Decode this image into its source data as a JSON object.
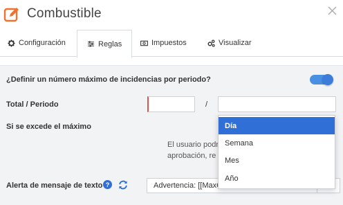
{
  "header": {
    "title": "Combustible",
    "brand_color": "#f0722f"
  },
  "tabs": [
    {
      "label": "Configuración",
      "icon": "gear-icon",
      "active": false
    },
    {
      "label": "Reglas",
      "icon": "sliders-icon",
      "active": true
    },
    {
      "label": "Impuestos",
      "icon": "money-icon",
      "active": false
    },
    {
      "label": "Visualizar",
      "icon": "gears-icon",
      "active": false
    }
  ],
  "form": {
    "max_question": "¿Definir un número máximo de incidencias por periodo?",
    "max_toggle_on": true,
    "total_label": "Total / Periodo",
    "total_value": "",
    "slash": "/",
    "period_value": "",
    "exceed_label": "Si se excede el máximo",
    "exceed_desc_line1": "El usuario podr",
    "exceed_desc_line2": "aprobación, re",
    "alert_label": "Alerta de mensaje de texto",
    "alert_value": "Advertencia: [[MaxC"
  },
  "dropdown": {
    "options": [
      "Día",
      "Semana",
      "Mes",
      "Año"
    ],
    "selected": "Día"
  },
  "colors": {
    "accent": "#2f6fd6",
    "toggle": "#4a90e2",
    "required_border": "#d9534f"
  }
}
